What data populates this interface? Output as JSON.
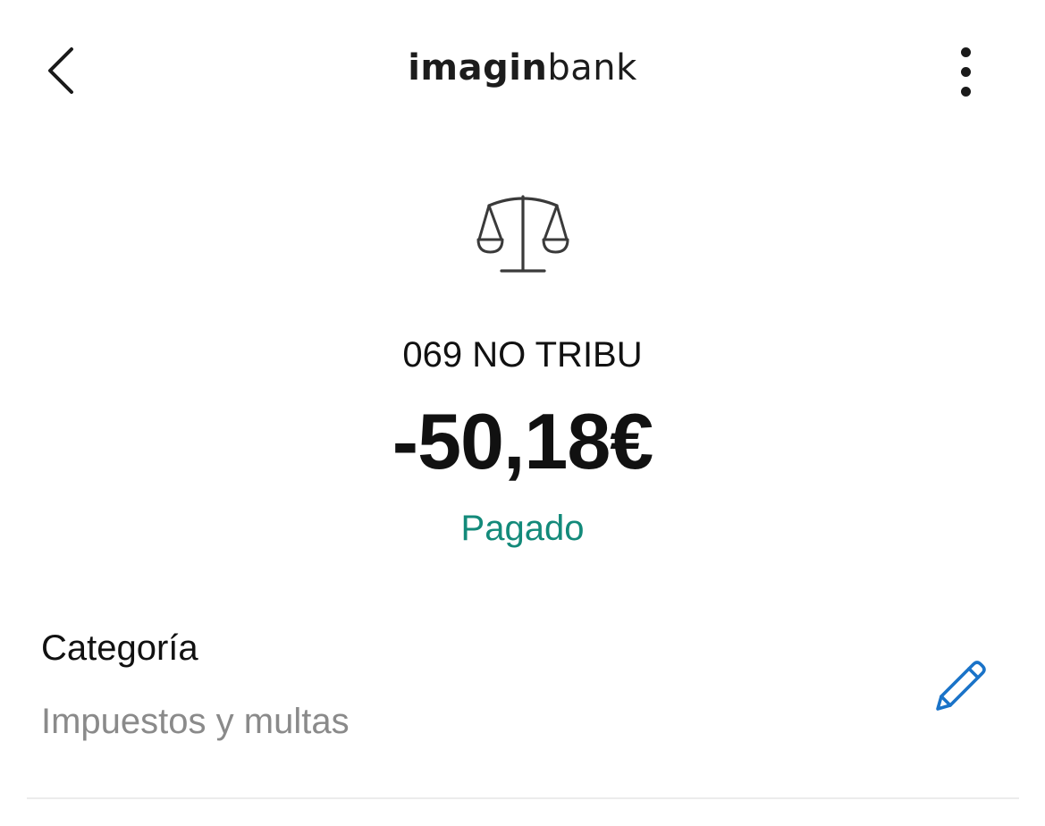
{
  "header": {
    "logo_bold": "imagin",
    "logo_light": "bank",
    "back_icon": "chevron-left-icon",
    "more_icon": "more-vertical-icon"
  },
  "transaction": {
    "icon": "scale-icon",
    "merchant": "069 NO TRIBU",
    "amount": "-50,18€",
    "status": "Pagado",
    "status_color": "#138a7a"
  },
  "category": {
    "label": "Categoría",
    "value": "Impuestos y multas",
    "edit_icon": "pencil-icon",
    "edit_icon_color": "#1a73c8"
  }
}
